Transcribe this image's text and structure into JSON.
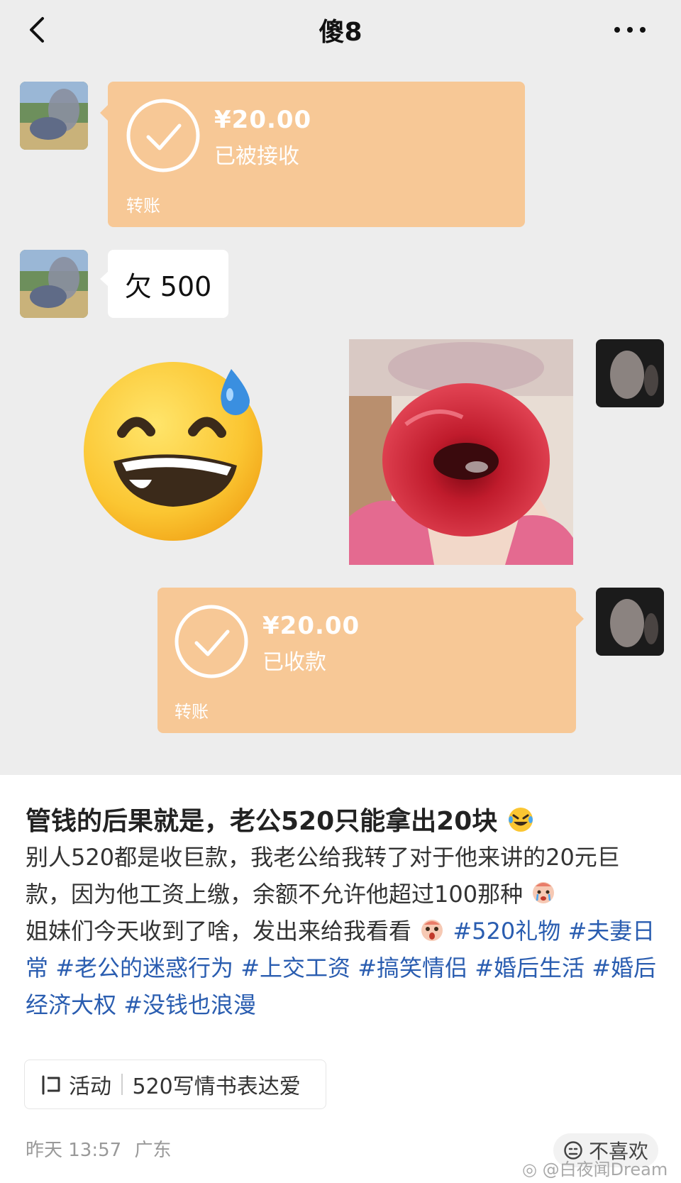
{
  "chat": {
    "title": "傻8",
    "messages": {
      "transfer_received": {
        "amount": "¥20.00",
        "status": "已被接收",
        "label": "转账"
      },
      "text_message": {
        "text": "欠 500"
      },
      "transfer_sent": {
        "amount": "¥20.00",
        "status": "已收款",
        "label": "转账"
      }
    }
  },
  "post": {
    "title": "管钱的后果就是，老公520只能拿出20块",
    "body_line1": "别人520都是收巨款，我老公给我转了对于他来讲的20元巨款，因为他工资上缴，余额不允许他超过100那种",
    "body_line2": "姐妹们今天收到了啥，发出来给我看看",
    "tags": [
      "#520礼物",
      "#夫妻日常",
      "#老公的迷惑行为",
      "#上交工资",
      "#搞笑情侣",
      "#婚后生活",
      "#婚后经济大权",
      "#没钱也浪漫"
    ],
    "activity": {
      "label": "活动",
      "name": "520写情书表达爱"
    },
    "meta": {
      "time": "昨天 13:57",
      "location": "广东"
    },
    "dislike_label": "不喜欢",
    "watermark": "@白夜闻Dream"
  },
  "colors": {
    "transfer_bubble": "#f7c896",
    "tag_link": "#2a5db0",
    "chat_background": "#ededed"
  }
}
